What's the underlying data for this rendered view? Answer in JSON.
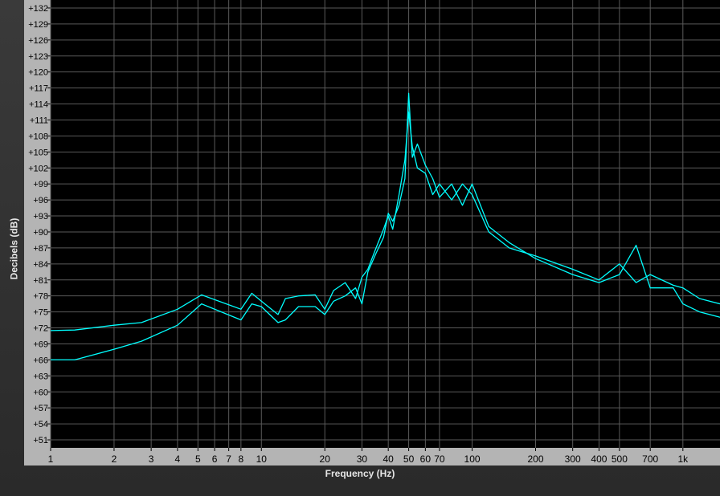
{
  "chart_data": {
    "type": "line",
    "xlabel": "Frequency (Hz)",
    "ylabel": "Decibels (dB)",
    "x_scale": "log",
    "xlim": [
      1,
      1500
    ],
    "ylim": [
      49.5,
      133.5
    ],
    "grid": true,
    "colors": {
      "plot_bg": "#000000",
      "frame_bg": "#b4b4b4",
      "grid": "#5a5a5a",
      "line": "#00ffff",
      "text": "#000000"
    },
    "x_ticks": [
      {
        "value": 1,
        "label": "1"
      },
      {
        "value": 2,
        "label": "2"
      },
      {
        "value": 3,
        "label": "3"
      },
      {
        "value": 4,
        "label": "4"
      },
      {
        "value": 5,
        "label": "5"
      },
      {
        "value": 6,
        "label": "6"
      },
      {
        "value": 7,
        "label": "7"
      },
      {
        "value": 8,
        "label": "8"
      },
      {
        "value": 10,
        "label": "10"
      },
      {
        "value": 20,
        "label": "20"
      },
      {
        "value": 30,
        "label": "30"
      },
      {
        "value": 40,
        "label": "40"
      },
      {
        "value": 50,
        "label": "50"
      },
      {
        "value": 60,
        "label": "60"
      },
      {
        "value": 70,
        "label": "70"
      },
      {
        "value": 100,
        "label": "100"
      },
      {
        "value": 200,
        "label": "200"
      },
      {
        "value": 300,
        "label": "300"
      },
      {
        "value": 400,
        "label": "400"
      },
      {
        "value": 500,
        "label": "500"
      },
      {
        "value": 700,
        "label": "700"
      },
      {
        "value": 1000,
        "label": "1k"
      }
    ],
    "y_ticks": [
      {
        "value": 132,
        "label": "+132"
      },
      {
        "value": 129,
        "label": "+129"
      },
      {
        "value": 126,
        "label": "+126"
      },
      {
        "value": 123,
        "label": "+123"
      },
      {
        "value": 120,
        "label": "+120"
      },
      {
        "value": 117,
        "label": "+117"
      },
      {
        "value": 114,
        "label": "+114"
      },
      {
        "value": 111,
        "label": "+111"
      },
      {
        "value": 108,
        "label": "+108"
      },
      {
        "value": 105,
        "label": "+105"
      },
      {
        "value": 102,
        "label": "+102"
      },
      {
        "value": 99,
        "label": "+99"
      },
      {
        "value": 96,
        "label": "+96"
      },
      {
        "value": 93,
        "label": "+93"
      },
      {
        "value": 90,
        "label": "+90"
      },
      {
        "value": 87,
        "label": "+87"
      },
      {
        "value": 84,
        "label": "+84"
      },
      {
        "value": 81,
        "label": "+81"
      },
      {
        "value": 78,
        "label": "+78"
      },
      {
        "value": 75,
        "label": "+75"
      },
      {
        "value": 72,
        "label": "+72"
      },
      {
        "value": 69,
        "label": "+69"
      },
      {
        "value": 66,
        "label": "+66"
      },
      {
        "value": 63,
        "label": "+63"
      },
      {
        "value": 60,
        "label": "+60"
      },
      {
        "value": 57,
        "label": "+57"
      },
      {
        "value": 54,
        "label": "+54"
      },
      {
        "value": 51,
        "label": "+51"
      }
    ],
    "series": [
      {
        "x": [
          1,
          1.3,
          2,
          2.7,
          4,
          5.2,
          8,
          9,
          10,
          12,
          13,
          15,
          18,
          20,
          22,
          25,
          28,
          30,
          32,
          35,
          38,
          40,
          42,
          45,
          48,
          50,
          52,
          55,
          60,
          65,
          70,
          80,
          90,
          100,
          120,
          150,
          200,
          300,
          400,
          500,
          600,
          700,
          900,
          1000,
          1200,
          1500
        ],
        "y": [
          71.5,
          71.6,
          72.5,
          73,
          75.5,
          78.2,
          75.5,
          78.5,
          77,
          74.5,
          77.5,
          78,
          78.2,
          75.5,
          79,
          80.5,
          77.5,
          81.5,
          83,
          87,
          90.5,
          93,
          90.5,
          97,
          103.5,
          112.5,
          106,
          102,
          101,
          97,
          99,
          96,
          99,
          97,
          90,
          87,
          85.5,
          83,
          81,
          84,
          80.5,
          82,
          80,
          79.5,
          77.5,
          76.5
        ]
      },
      {
        "x": [
          1,
          1.3,
          2,
          2.7,
          4,
          5.2,
          8,
          9,
          10,
          12,
          13,
          15,
          18,
          20,
          22,
          25,
          28,
          30,
          32,
          35,
          38,
          40,
          42,
          45,
          48,
          50,
          52,
          55,
          60,
          65,
          70,
          80,
          90,
          100,
          120,
          150,
          200,
          300,
          400,
          500,
          600,
          700,
          900,
          1000,
          1200,
          1500
        ],
        "y": [
          66,
          66,
          68,
          69.5,
          72.5,
          76.5,
          73.5,
          76.5,
          76,
          73,
          73.5,
          76,
          76,
          74.5,
          77,
          78,
          79.5,
          76.5,
          82.5,
          86,
          89,
          93.5,
          92,
          95,
          100,
          116,
          104,
          106.5,
          102.5,
          100,
          96.5,
          99,
          95,
          99,
          91,
          88,
          85,
          82,
          80.5,
          82,
          87.5,
          79.5,
          79.5,
          76.5,
          75,
          74
        ]
      }
    ]
  }
}
